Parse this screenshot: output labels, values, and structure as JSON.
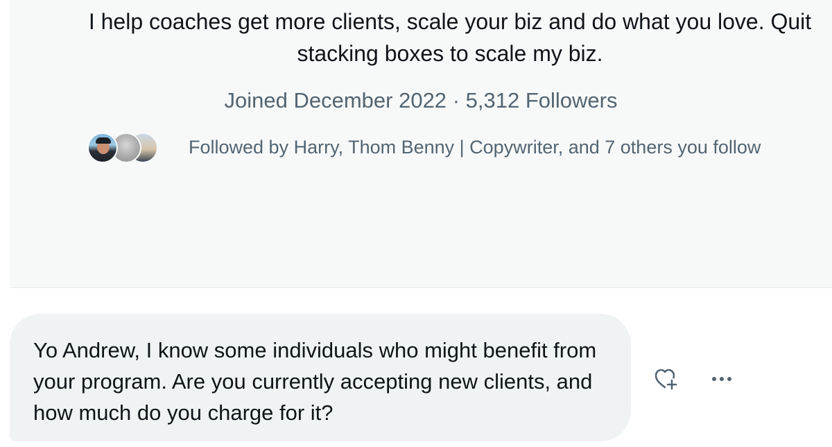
{
  "profile": {
    "bio": "I help coaches get more clients, scale your biz and do what you love. Quit stacking boxes to scale my biz.",
    "joined": "Joined December 2022",
    "separator": "·",
    "followers": "5,312 Followers",
    "followed_by": "Followed by Harry, Thom Benny | Copywriter, and 7 others you follow"
  },
  "message": {
    "text": "Yo Andrew, I know some individuals who might benefit from your program. Are you currently accepting new clients, and how much do you charge for it?"
  },
  "actions": {
    "react_icon": "heart-plus-icon",
    "more_icon": "more-options-icon"
  },
  "colors": {
    "card_background": "#f7f9f9",
    "bubble_background": "#eff3f4",
    "primary_text": "#0f1419",
    "secondary_text": "#536471"
  }
}
